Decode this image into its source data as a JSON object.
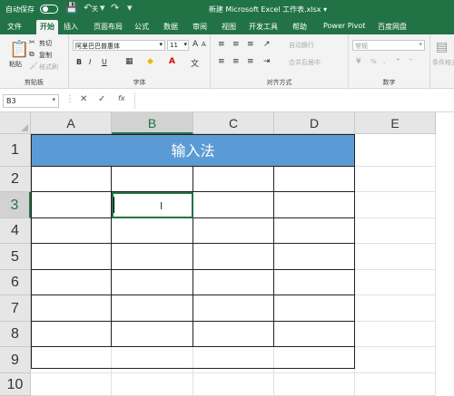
{
  "titlebar": {
    "autosave_label": "自动保存",
    "autosave_state": "关",
    "title": "新建 Microsoft Excel 工作表.xlsx",
    "title_arrow": "▾"
  },
  "tabs": [
    "文件",
    "开始",
    "插入",
    "页面布局",
    "公式",
    "数据",
    "审阅",
    "视图",
    "开发工具",
    "帮助",
    "Power Pivot",
    "百度网盘"
  ],
  "active_tab": "开始",
  "ribbon": {
    "clipboard": {
      "paste": "粘贴",
      "cut": "剪切",
      "copy": "复制",
      "format_painter": "格式刷",
      "label": "剪贴板"
    },
    "font": {
      "name": "阿里巴巴普惠体",
      "size": "11",
      "bold": "B",
      "italic": "I",
      "underline": "U",
      "label": "字体",
      "grow": "A",
      "shrink": "A"
    },
    "alignment": {
      "wrap": "自动换行",
      "merge": "合并后居中",
      "label": "对齐方式"
    },
    "number": {
      "format": "常规",
      "label": "数字",
      "percent": "%",
      "comma": ","
    },
    "styles": {
      "conditional": "条件格式"
    }
  },
  "formula_bar": {
    "name_box": "B3",
    "cancel": "✕",
    "enter": "✓",
    "fx": "fx",
    "value": ""
  },
  "grid": {
    "columns": [
      "A",
      "B",
      "C",
      "D",
      "E"
    ],
    "rows": [
      "1",
      "2",
      "3",
      "4",
      "5",
      "6",
      "7",
      "8",
      "9",
      "10"
    ],
    "selected_cell": "B3",
    "merged_header_text": "输入法",
    "header_color": "#5b9bd5"
  },
  "colors": {
    "accent": "#217346"
  }
}
